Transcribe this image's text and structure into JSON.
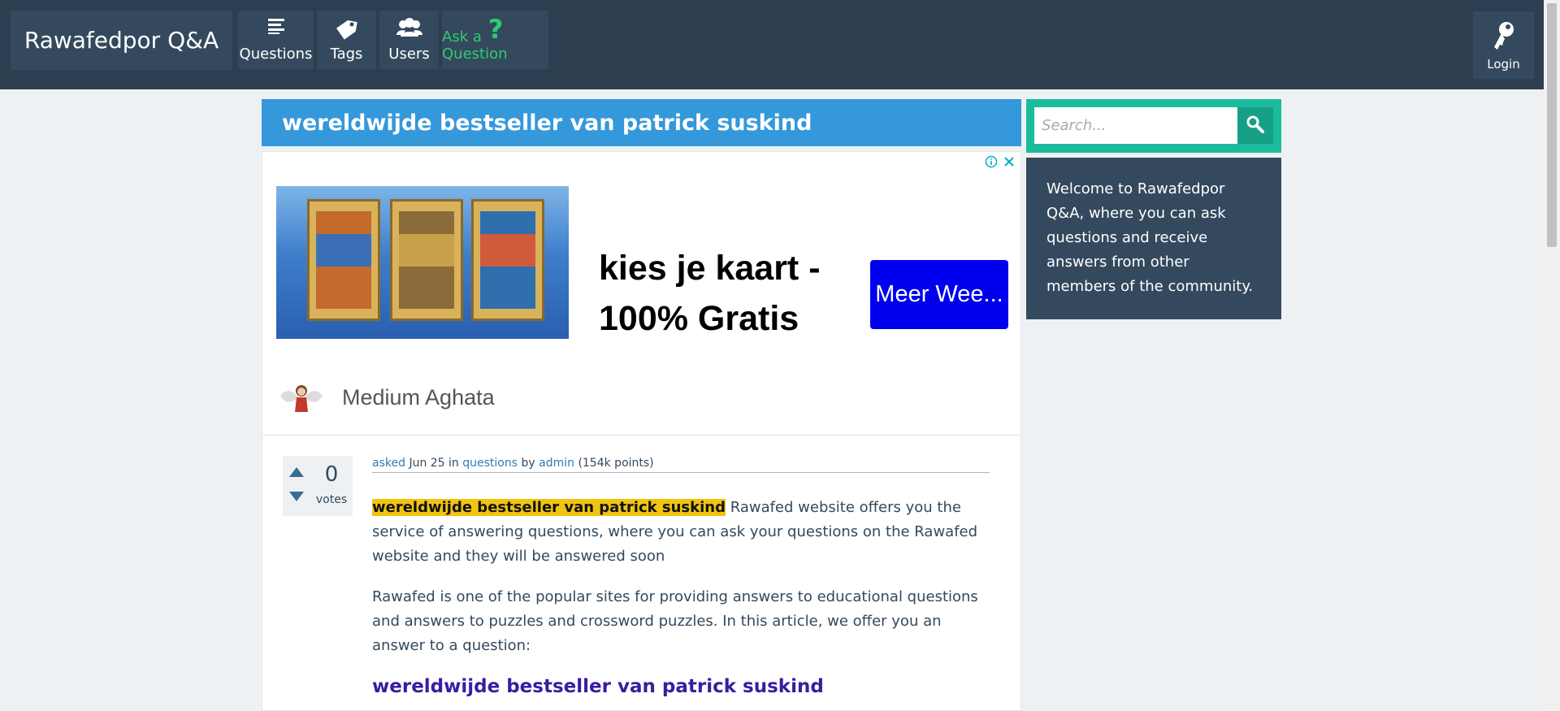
{
  "nav": {
    "logo": "Rawafedpor Q&A",
    "items": [
      {
        "label": "Questions",
        "icon": "list-icon"
      },
      {
        "label": "Tags",
        "icon": "tag-icon"
      },
      {
        "label": "Users",
        "icon": "users-icon"
      },
      {
        "label": "Ask a Question",
        "icon": "question-mark-icon"
      }
    ],
    "login": {
      "label": "Login",
      "icon": "key-icon"
    }
  },
  "question": {
    "title": "wereldwijde bestseller van patrick suskind",
    "votes": "0",
    "votes_label": "votes",
    "meta": {
      "asked": "asked",
      "date": "Jun 25",
      "in": "in",
      "category": "questions",
      "by": "by",
      "author": "admin",
      "points": "(154k points)"
    },
    "highlight": "wereldwijde bestseller van patrick suskind",
    "intro_rest": "Rawafed website offers you the service of answering questions, where you can ask your questions on the Rawafed website and they will be answered soon",
    "para2": "Rawafed is one of the popular sites for providing answers to educational questions and answers to puzzles and crossword puzzles. In this article, we offer you an answer to a question:",
    "subheading": "wereldwijde bestseller van patrick suskind"
  },
  "ad": {
    "headline": "kies je kaart - 100% Gratis",
    "button": "Meer Wee...",
    "brand": "Medium Aghata"
  },
  "sidebar": {
    "search_placeholder": "Search...",
    "welcome": "Welcome to Rawafedpor Q&A, where you can ask questions and receive answers from other members of the community."
  },
  "colors": {
    "nav_bg": "#2c3e50",
    "title_bg": "#3498db",
    "search_bg": "#1abc9c",
    "accent_green": "#2ecc71",
    "highlight": "#f1c40f",
    "ad_button": "#0000ee"
  }
}
